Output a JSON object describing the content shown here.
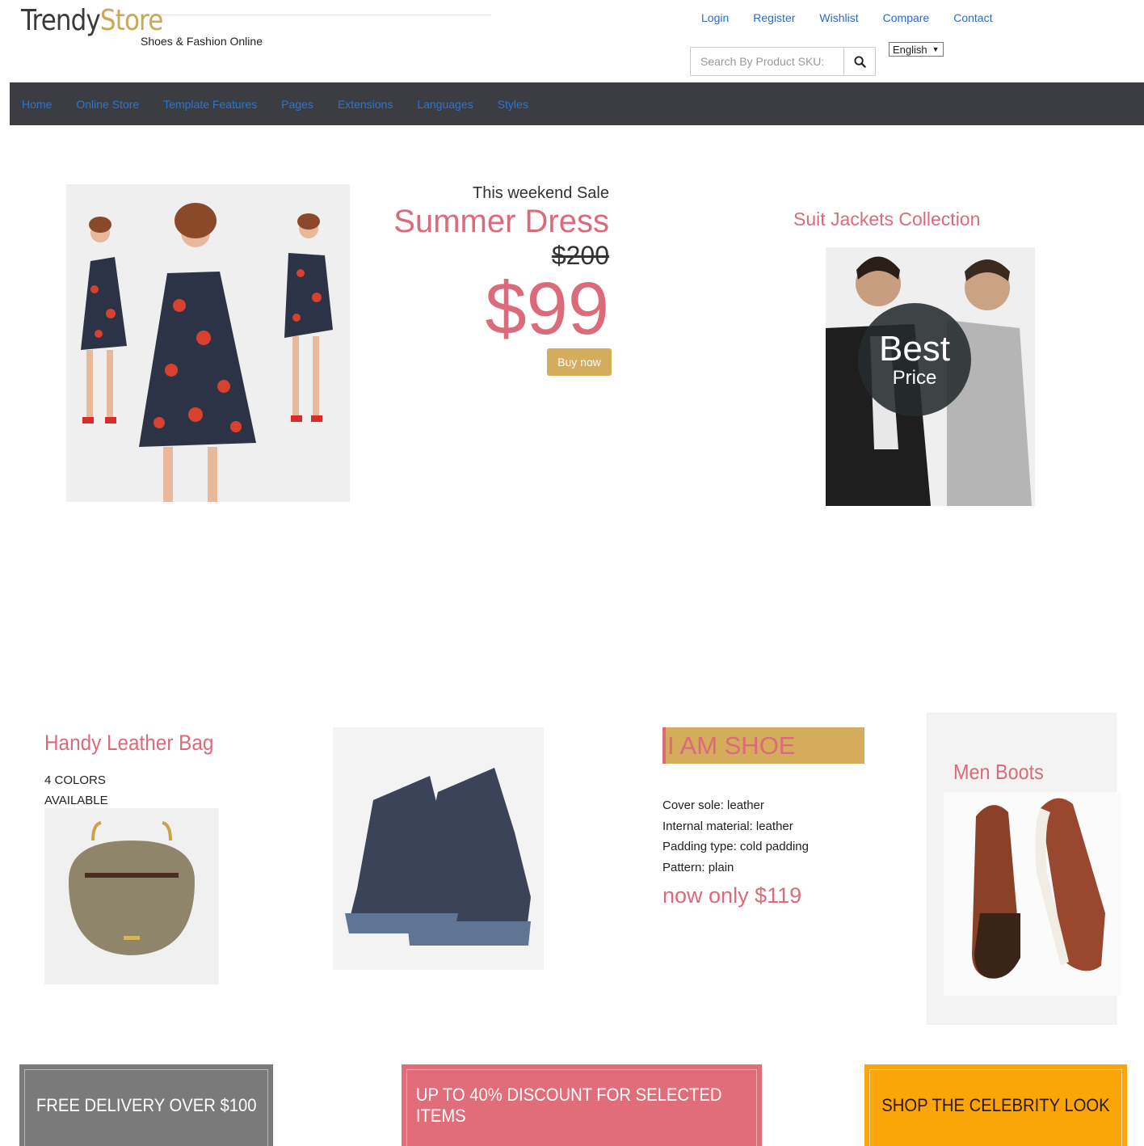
{
  "header": {
    "logo_part1": "Trendy",
    "logo_part2": "Store",
    "tagline": "Shoes & Fashion Online",
    "top_links": [
      "Login",
      "Register",
      "Wishlist",
      "Compare",
      "Contact"
    ],
    "search_placeholder": "Search By Product SKU:",
    "language": "English"
  },
  "nav": {
    "items": [
      "Home",
      "Online Store",
      "Template Features",
      "Pages",
      "Extensions",
      "Languages",
      "Styles"
    ]
  },
  "hero": {
    "kicker": "This weekend Sale",
    "title": "Summer Dress",
    "old_price": "$200",
    "new_price": "$99",
    "buy_label": "Buy now",
    "suit_title": "Suit Jackets Collection",
    "badge_line1": "Best",
    "badge_line2": "Price"
  },
  "products": {
    "bag_title": "Handy Leather Bag",
    "bag_colors": "4 COLORS AVAILABLE",
    "shoe_banner": "I AM SHOE",
    "shoe_specs": [
      "Cover sole: leather",
      "Internal material: leather",
      "Padding type: cold padding",
      "Pattern: plain"
    ],
    "shoe_price": "now only $119",
    "boots_title": "Men Boots"
  },
  "promos": {
    "delivery": "FREE DELIVERY OVER $100",
    "discount": "UP TO 40% DISCOUNT FOR SELECTED ITEMS",
    "celebrity": "SHOP THE CELEBRITY LOOK"
  },
  "colors": {
    "accent_pink": "#db6b7a",
    "gold": "#d5ab5c",
    "nav_bg": "#3c3d42",
    "link_blue": "#2a6bc4"
  }
}
